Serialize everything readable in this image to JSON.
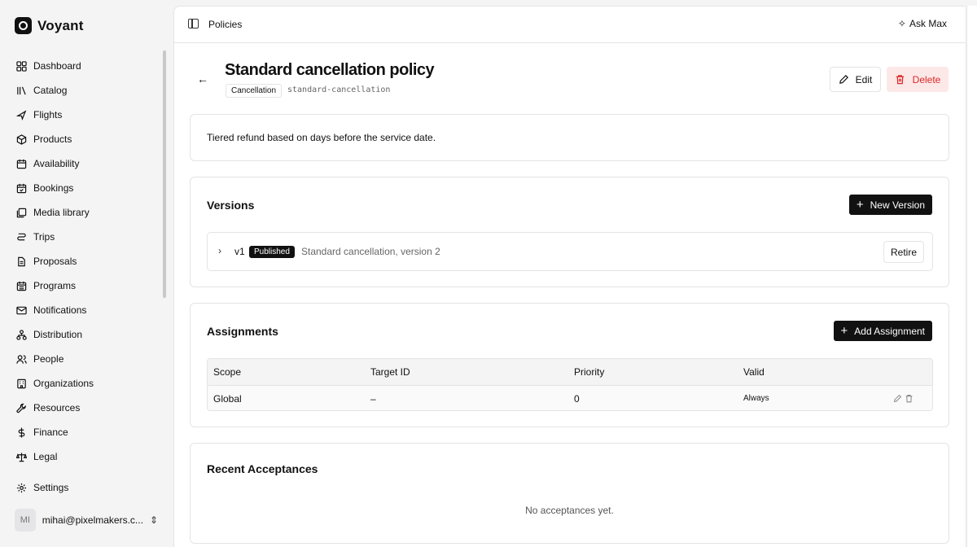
{
  "brand": {
    "name": "Voyant"
  },
  "sidebar": {
    "items": [
      {
        "label": "Dashboard",
        "icon": "dashboard-icon"
      },
      {
        "label": "Catalog",
        "icon": "catalog-icon"
      },
      {
        "label": "Flights",
        "icon": "plane-icon"
      },
      {
        "label": "Products",
        "icon": "package-icon"
      },
      {
        "label": "Availability",
        "icon": "calendar-icon"
      },
      {
        "label": "Bookings",
        "icon": "calendar-check-icon"
      },
      {
        "label": "Media library",
        "icon": "image-icon"
      },
      {
        "label": "Trips",
        "icon": "route-icon"
      },
      {
        "label": "Proposals",
        "icon": "file-icon"
      },
      {
        "label": "Programs",
        "icon": "calendar-grid-icon"
      },
      {
        "label": "Notifications",
        "icon": "mail-icon"
      },
      {
        "label": "Distribution",
        "icon": "network-icon"
      },
      {
        "label": "People",
        "icon": "people-icon"
      },
      {
        "label": "Organizations",
        "icon": "building-icon"
      },
      {
        "label": "Resources",
        "icon": "wrench-icon"
      },
      {
        "label": "Finance",
        "icon": "dollar-icon"
      },
      {
        "label": "Legal",
        "icon": "scale-icon"
      }
    ],
    "settings": {
      "label": "Settings",
      "icon": "gear-icon"
    },
    "user": {
      "initials": "MI",
      "email": "mihai@pixelmakers.c..."
    }
  },
  "topbar": {
    "breadcrumb": "Policies",
    "ask_label": "Ask Max"
  },
  "policy": {
    "title": "Standard cancellation policy",
    "type_badge": "Cancellation",
    "slug": "standard-cancellation",
    "description": "Tiered refund based on days before the service date.",
    "edit_label": "Edit",
    "delete_label": "Delete"
  },
  "versions": {
    "title": "Versions",
    "new_label": "New Version",
    "rows": [
      {
        "version": "v1",
        "status": "Published",
        "description": "Standard cancellation, version 2",
        "action": "Retire"
      }
    ]
  },
  "assignments": {
    "title": "Assignments",
    "add_label": "Add Assignment",
    "columns": [
      "Scope",
      "Target ID",
      "Priority",
      "Valid"
    ],
    "rows": [
      {
        "scope": "Global",
        "target": "–",
        "priority": "0",
        "valid": "Always"
      }
    ]
  },
  "acceptances": {
    "title": "Recent Acceptances",
    "empty": "No acceptances yet."
  },
  "colors": {
    "accent": "#111111",
    "danger": "#dc2626",
    "danger_bg": "#fde8e8",
    "sidebar_bg": "#f4f4f5"
  }
}
